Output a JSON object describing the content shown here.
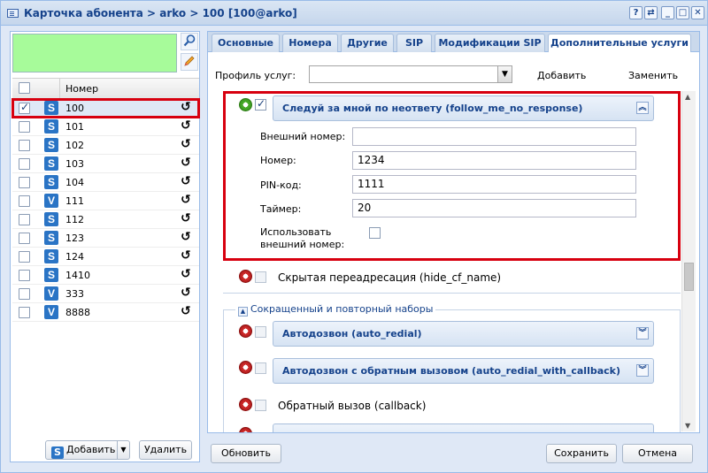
{
  "window": {
    "title": "Карточка абонента > arko > 100 [100@arko]",
    "tools": [
      "?",
      "⇄",
      "_",
      "□",
      "✕"
    ]
  },
  "left": {
    "search_icon": "search-icon",
    "edit_icon": "edit-icon",
    "column_number": "Номер",
    "rows": [
      {
        "number": "100",
        "type": "S",
        "checked": true
      },
      {
        "number": "101",
        "type": "S",
        "checked": false
      },
      {
        "number": "102",
        "type": "S",
        "checked": false
      },
      {
        "number": "103",
        "type": "S",
        "checked": false
      },
      {
        "number": "104",
        "type": "S",
        "checked": false
      },
      {
        "number": "111",
        "type": "V",
        "checked": false
      },
      {
        "number": "112",
        "type": "S",
        "checked": false
      },
      {
        "number": "123",
        "type": "S",
        "checked": false
      },
      {
        "number": "124",
        "type": "S",
        "checked": false
      },
      {
        "number": "1410",
        "type": "S",
        "checked": false
      },
      {
        "number": "333",
        "type": "V",
        "checked": false
      },
      {
        "number": "8888",
        "type": "V",
        "checked": false
      }
    ],
    "add_button": "Добавить",
    "delete_button": "Удалить"
  },
  "tabs": [
    {
      "label": "Основные"
    },
    {
      "label": "Номера"
    },
    {
      "label": "Другие"
    },
    {
      "label": "SIP"
    },
    {
      "label": "Модификации SIP"
    },
    {
      "label": "Дополнительные услуги"
    }
  ],
  "profile": {
    "label": "Профиль услуг:",
    "value": "",
    "add": "Добавить",
    "replace": "Заменить"
  },
  "follow_me": {
    "title": "Следуй за мной по неответу (follow_me_no_response)",
    "fields": [
      {
        "label": "Внешний номер:",
        "value": ""
      },
      {
        "label": "Номер:",
        "value": "1234"
      },
      {
        "label": "PIN-код:",
        "value": "1111"
      },
      {
        "label": "Таймер:",
        "value": "20"
      }
    ],
    "use_external_label_1": "Использовать",
    "use_external_label_2": "внешний номер:"
  },
  "hidden_redirect": "Скрытая переадресация (hide_cf_name)",
  "group": {
    "legend": "Сокращенный и повторный наборы",
    "auto_redial": "Автодозвон (auto_redial)",
    "auto_redial_cb": "Автодозвон с обратным вызовом (auto_redial_with_callback)",
    "callback": "Обратный вызов (callback)"
  },
  "footer": {
    "refresh": "Обновить",
    "save": "Сохранить",
    "cancel": "Отмена"
  }
}
